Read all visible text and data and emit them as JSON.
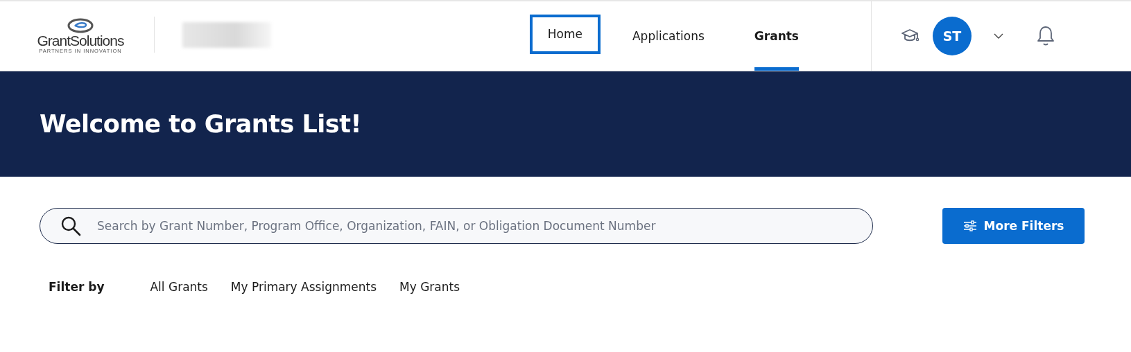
{
  "header": {
    "logo": {
      "name": "GrantSolutions",
      "tagline": "PARTNERS IN INNOVATION"
    },
    "nav": [
      {
        "label": "Home",
        "selected": false,
        "focused": true
      },
      {
        "label": "Applications",
        "selected": false,
        "focused": false
      },
      {
        "label": "Grants",
        "selected": true,
        "focused": false
      }
    ],
    "avatar": "ST"
  },
  "banner": {
    "title": "Welcome to Grants List!"
  },
  "search": {
    "placeholder": "Search by Grant Number, Program Office, Organization, FAIN, or Obligation Document Number"
  },
  "more_filters": "More Filters",
  "filter": {
    "label": "Filter by",
    "options": [
      "All Grants",
      "My Primary Assignments",
      "My Grants"
    ]
  }
}
